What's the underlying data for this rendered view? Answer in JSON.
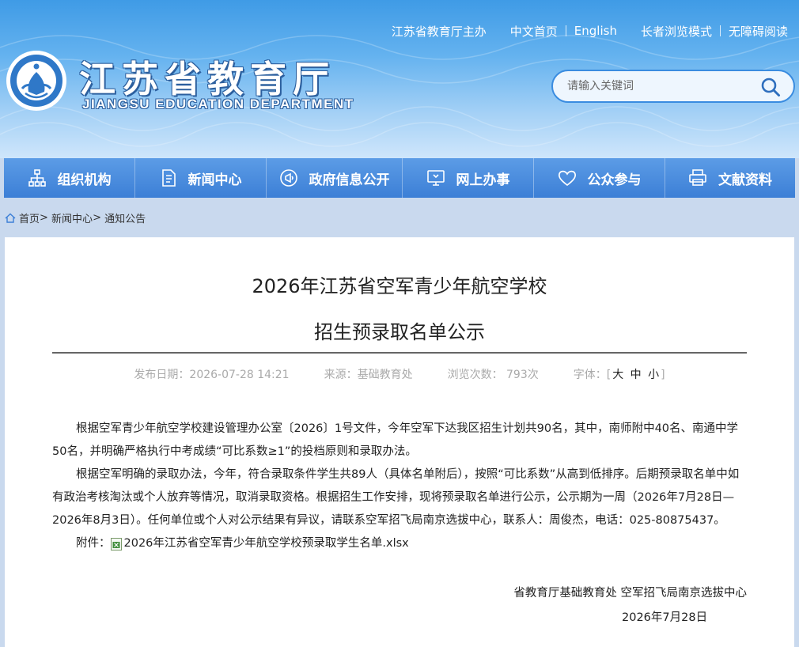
{
  "header": {
    "top_links": [
      "江苏省教育厅主办",
      "中文首页",
      "English",
      "长者浏览模式",
      "无障碍阅读"
    ],
    "title": "江苏省教育厅",
    "subtitle": "JIANGSU EDUCATION DEPARTMENT",
    "search": {
      "placeholder": "请输入关键词"
    }
  },
  "nav": {
    "items": [
      {
        "label": "组织机构",
        "icon": "org-chart-icon"
      },
      {
        "label": "新闻中心",
        "icon": "document-icon"
      },
      {
        "label": "政府信息公开",
        "icon": "megaphone-icon"
      },
      {
        "label": "网上办事",
        "icon": "monitor-icon"
      },
      {
        "label": "公众参与",
        "icon": "heart-icon"
      },
      {
        "label": "文献资料",
        "icon": "printer-icon"
      }
    ]
  },
  "breadcrumb": [
    "首页",
    "新闻中心",
    "通知公告"
  ],
  "article": {
    "title_line1": "2026年江苏省空军青少年航空学校",
    "title_line2": "招生预录取名单公示",
    "meta": {
      "date": "发布日期：2026-07-28 14:21",
      "source": "来源：基础教育处",
      "views": "浏览次数： 793次",
      "font_label": "字体：[",
      "font_large": "大",
      "font_medium": "中",
      "font_small": "小",
      "font_close": "]"
    },
    "paragraphs": [
      "根据空军青少年航空学校建设管理办公室〔2026〕1号文件，今年空军下达我区招生计划共90名，其中，南师附中40名、南通中学50名，并明确严格执行中考成绩“可比系数≥1”的投档原则和录取办法。",
      "根据空军明确的录取办法，今年，符合录取条件学生共89人（具体名单附后），按照“可比系数”从高到低排序。后期预录取名单中如有政治考核淘汰或个人放弃等情况，取消录取资格。根据招生工作安排，现将预录取名单进行公示，公示期为一周（2026年7月28日—2026年8月3日）。任何单位或个人对公示结果有异议，请联系空军招飞局南京选拔中心，联系人：周俊杰，电话：025-80875437。"
    ],
    "attachment_label": "附件：",
    "attachment_file": "2026年江苏省空军青少年航空学校预录取学生名单.xlsx",
    "signature": "省教育厅基础教育处  空军招飞局南京选拔中心",
    "sign_date": "2026年7月28日"
  },
  "colors": {
    "nav_bg": "#3c7fd6",
    "header_top": "#3f9be6",
    "search_border": "#3a8ce0"
  }
}
